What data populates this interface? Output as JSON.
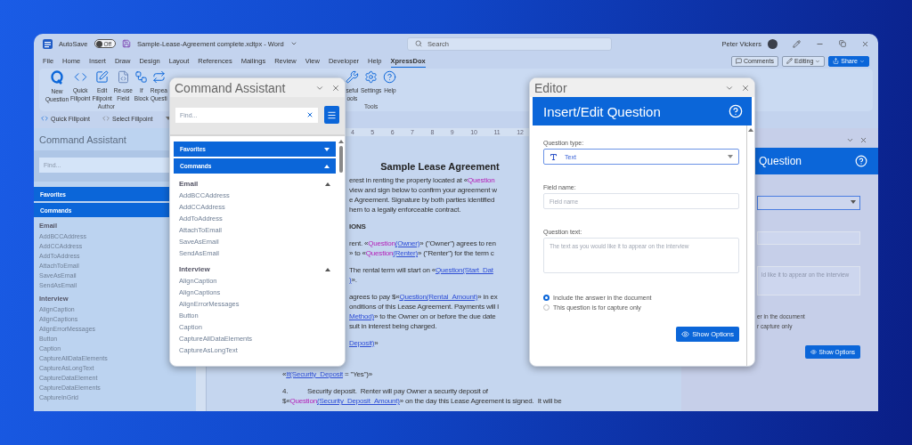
{
  "title_bar": {
    "autosave_label": "AutoSave",
    "autosave": {
      "on": false,
      "label": "Off"
    },
    "document_title": "Sample-Lease-Agreement complete.xdtpx - Word",
    "search": {
      "placeholder": "Search"
    },
    "user_name": "Peter Vickers"
  },
  "menu_tabs": [
    {
      "label": "File",
      "selected": false
    },
    {
      "label": "Home",
      "selected": false
    },
    {
      "label": "Insert",
      "selected": false
    },
    {
      "label": "Draw",
      "selected": false
    },
    {
      "label": "Design",
      "selected": false
    },
    {
      "label": "Layout",
      "selected": false
    },
    {
      "label": "References",
      "selected": false
    },
    {
      "label": "Mailings",
      "selected": false
    },
    {
      "label": "Review",
      "selected": false
    },
    {
      "label": "View",
      "selected": false
    },
    {
      "label": "Developer",
      "selected": false
    },
    {
      "label": "Help",
      "selected": false
    },
    {
      "label": "XpressDox",
      "selected": true
    }
  ],
  "action_buttons": [
    {
      "label": "Comments",
      "kind": "comments"
    },
    {
      "label": "Editing",
      "kind": "editing"
    },
    {
      "label": "Share",
      "kind": "share"
    }
  ],
  "ribbon_groups": [
    {
      "label": "Author",
      "buttons": [
        {
          "lines": [
            "New",
            "Question"
          ],
          "kind": "question"
        },
        {
          "lines": [
            "Quick",
            "Fillpoint"
          ],
          "kind": "code"
        },
        {
          "lines": [
            "Edit",
            "Fillpoint"
          ],
          "kind": "edit"
        },
        {
          "lines": [
            "Re-use",
            "Field"
          ],
          "kind": "reuse"
        },
        {
          "lines": [
            "If",
            "Block"
          ],
          "kind": "block"
        },
        {
          "lines": [
            "Repea",
            "Questi"
          ],
          "kind": "repeat"
        }
      ]
    },
    {
      "label": "Tools",
      "buttons": [
        {
          "lines": [
            "seful",
            "ools"
          ],
          "kind": "tools"
        },
        {
          "lines": [
            "Settings"
          ],
          "kind": "settings"
        },
        {
          "lines": [
            "Help"
          ],
          "kind": "help"
        }
      ]
    }
  ],
  "quick_bar": [
    {
      "label": "Quick Fillpoint"
    },
    {
      "label": "Select Fillpoint"
    }
  ],
  "docked_assistant": {
    "title": "Command Assistant",
    "search": {
      "placeholder": "Find..."
    },
    "sections": [
      "Favorites",
      "Commands"
    ],
    "groups": [
      {
        "label": "Email",
        "items": [
          "AddBCCAddress",
          "AddCCAddress",
          "AddToAddress",
          "AttachToEmail",
          "SaveAsEmail",
          "SendAsEmail"
        ]
      },
      {
        "label": "Interview",
        "items": [
          "AlignCaption",
          "AlignCaptions",
          "AlignErrorMessages",
          "Button",
          "Caption",
          "CaptureAllDataElements",
          "CaptureAsLongText",
          "CaptureDataElement",
          "CaptureDataElements",
          "CaptureInGrid"
        ]
      }
    ]
  },
  "ruler_marks": [
    "4",
    "5",
    "6",
    "7",
    "8",
    "9",
    "10",
    "11",
    "12"
  ],
  "document": {
    "title": "Sample Lease Agreement",
    "paragraphs": [
      [
        [
          {
            "text": "erest in renting the property located at «",
            "kind": "plain"
          },
          {
            "text": "Question",
            "kind": "keyword"
          }
        ],
        [
          {
            "text": "view and sign below to confirm your agreement w",
            "kind": "plain"
          }
        ],
        [
          {
            "text": "e Agreement. Signature by both parties identified",
            "kind": "plain"
          }
        ],
        [
          {
            "text": "hem to a legally enforceable contract.",
            "kind": "plain"
          }
        ]
      ],
      [
        [
          {
            "text": "IONS",
            "kind": "bold"
          }
        ]
      ],
      [
        [
          {
            "text": "rent. «",
            "kind": "plain"
          },
          {
            "text": "Question",
            "kind": "keyword"
          },
          {
            "text": "(Owner)",
            "kind": "field"
          },
          {
            "text": "» (\"Owner\") agrees to ren",
            "kind": "plain"
          }
        ],
        [
          {
            "text": "» to «",
            "kind": "plain"
          },
          {
            "text": "Question",
            "kind": "keyword"
          },
          {
            "text": "(Renter)",
            "kind": "field"
          },
          {
            "text": "» (\"Renter\") for the term c",
            "kind": "plain"
          }
        ]
      ],
      [
        [
          {
            "text": "The rental term will start on «",
            "kind": "plain"
          },
          {
            "text": "Question(Start_Dat",
            "kind": "field"
          }
        ],
        [
          {
            "text": ")",
            "kind": "field"
          },
          {
            "text": "».",
            "kind": "plain"
          }
        ]
      ],
      [
        [
          {
            "text": "agrees to pay $«",
            "kind": "plain"
          },
          {
            "text": "Question(Rental_Amount)",
            "kind": "field"
          },
          {
            "text": "» in ex",
            "kind": "plain"
          }
        ],
        [
          {
            "text": "onditions of this Lease Agreement. Payments will l",
            "kind": "plain"
          }
        ],
        [
          {
            "text": "Method)",
            "kind": "field"
          },
          {
            "text": "» to the Owner on or before the due date",
            "kind": "plain"
          }
        ],
        [
          {
            "text": "sult in interest being charged.",
            "kind": "plain"
          }
        ]
      ],
      [
        [
          {
            "text": "Deposit)",
            "kind": "field"
          },
          {
            "text": "»",
            "kind": "plain"
          }
        ]
      ]
    ],
    "full_paragraphs": [
      [
        [
          {
            "text": "«",
            "kind": "plain"
          },
          {
            "text": "If(Security_Deposit",
            "kind": "field"
          },
          {
            "text": " = \"Yes\")»",
            "kind": "plain"
          }
        ]
      ],
      [
        [
          {
            "text": "4.",
            "kind": "number"
          },
          {
            "text": "Security deposit.  Renter will pay Owner a security deposit of",
            "kind": "plain"
          }
        ],
        [
          {
            "text": "$«",
            "kind": "plain"
          },
          {
            "text": "Question",
            "kind": "keyword"
          },
          {
            "text": "(Security_Deposit_Amount)",
            "kind": "field"
          },
          {
            "text": "» on the day this Lease Agreement is signed.  It will be",
            "kind": "plain"
          }
        ]
      ]
    ]
  },
  "floating_assistant": {
    "title": "Command Assistant",
    "search": {
      "placeholder": "Find..."
    },
    "sections": [
      {
        "label": "Favorites",
        "expanded": false
      },
      {
        "label": "Commands",
        "expanded": true
      }
    ],
    "groups": [
      {
        "label": "Email",
        "expanded": true,
        "items": [
          "AddBCCAddress",
          "AddCCAddress",
          "AddToAddress",
          "AttachToEmail",
          "SaveAsEmail",
          "SendAsEmail"
        ]
      },
      {
        "label": "Interview",
        "expanded": true,
        "items": [
          "AlignCaption",
          "AlignCaptions",
          "AlignErrorMessages",
          "Button",
          "Caption",
          "CaptureAllDataElements",
          "CaptureAsLongText"
        ]
      }
    ]
  },
  "editor": {
    "title": "Editor",
    "heading": "Insert/Edit Question",
    "question_type": {
      "label": "Question type:",
      "value": "Text"
    },
    "field_name": {
      "label": "Field name:",
      "placeholder": "Field name"
    },
    "question_text": {
      "label": "Question text:",
      "placeholder": "The text as you would like it to appear on the interview"
    },
    "options": [
      {
        "label": "Include the answer in the document",
        "selected": true
      },
      {
        "label": "This question is for capture only",
        "selected": false
      }
    ],
    "button": "Show Options"
  },
  "docked_editor": {
    "heading": "Question",
    "placeholder_fragment": "ld like it to appear on the interview",
    "option_fragments": [
      "er in the document",
      "r capture only"
    ],
    "button": "Show Options"
  }
}
